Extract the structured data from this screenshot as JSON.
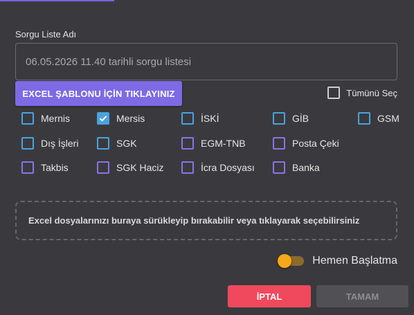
{
  "query": {
    "label": "Sorgu Liste Adı",
    "value": "06.05.2026 11.40 tarihli sorgu listesi"
  },
  "excel_template_button": "EXCEL ŞABLONU İÇİN TIKLAYINIZ",
  "select_all": {
    "label": "Tümünü Seç",
    "checked": false
  },
  "sources": [
    {
      "label": "Mernis",
      "checked": false,
      "style": "blue"
    },
    {
      "label": "Mersis",
      "checked": true,
      "style": "blue"
    },
    {
      "label": "İSKİ",
      "checked": false,
      "style": "blue"
    },
    {
      "label": "GİB",
      "checked": false,
      "style": "blue"
    },
    {
      "label": "GSM",
      "checked": false,
      "style": "blue"
    },
    {
      "label": "Dış İşleri",
      "checked": false,
      "style": "blue"
    },
    {
      "label": "SGK",
      "checked": false,
      "style": "blue"
    },
    {
      "label": "EGM-TNB",
      "checked": false,
      "style": "purple"
    },
    {
      "label": "Posta Çeki",
      "checked": false,
      "style": "purple"
    },
    {
      "label": "Takbis",
      "checked": false,
      "style": "purple"
    },
    {
      "label": "SGK Haciz",
      "checked": false,
      "style": "purple"
    },
    {
      "label": "İcra Dosyası",
      "checked": false,
      "style": "purple"
    },
    {
      "label": "Banka",
      "checked": false,
      "style": "purple"
    }
  ],
  "dropzone": {
    "text": "Excel dosyalarınızı buraya sürükleyip bırakabilir veya tıklayarak seçebilirsiniz"
  },
  "immediate_start": {
    "label": "Hemen Başlatma",
    "on": false
  },
  "buttons": {
    "cancel": "İPTAL",
    "ok": "TAMAM"
  },
  "colors": {
    "background": "#3a3a3e",
    "accent_purple": "#7e6ae4",
    "checkbox_blue": "#4aa3df",
    "checkbox_purple": "#8b73e6",
    "cancel_red": "#f0495e",
    "toggle_orange": "#f7a81a"
  }
}
